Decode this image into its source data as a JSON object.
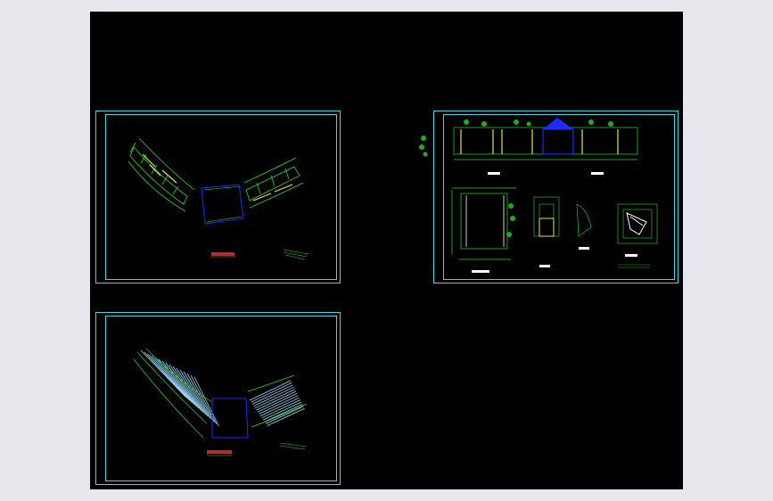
{
  "viewport": {
    "background": "#000000",
    "frame_color": "#3fd7e2",
    "line_green": "#22dd22",
    "line_yellow": "#e8e050",
    "line_blue": "#1c2cff",
    "line_white": "#ffffff"
  },
  "sheets": [
    {
      "id": "sheet-1",
      "content": "pergola-plan-view"
    },
    {
      "id": "sheet-2",
      "content": "pergola-roof-plan-view"
    },
    {
      "id": "sheet-3",
      "content": "elevations-and-details"
    }
  ]
}
